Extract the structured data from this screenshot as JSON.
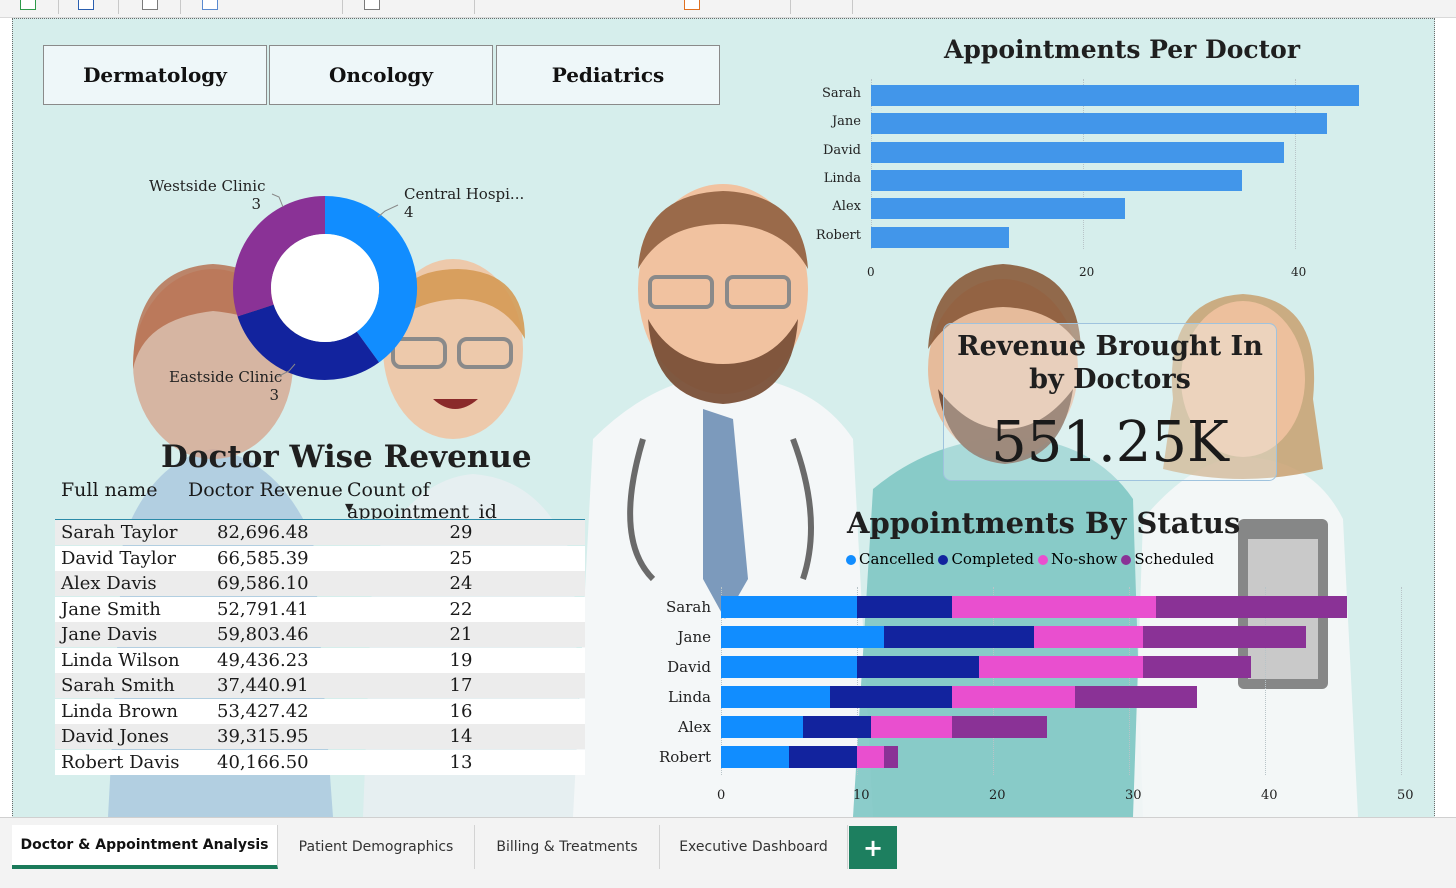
{
  "slicers": [
    "Dermatology",
    "Oncology",
    "Pediatrics"
  ],
  "donut": {
    "slices": [
      {
        "label": "Central Hospi...",
        "value": 4,
        "color": "#118dff"
      },
      {
        "label": "Eastside Clinic",
        "value": 3,
        "color": "#12239e"
      },
      {
        "label": "Westside Clinic",
        "value": 3,
        "color": "#8a3296"
      }
    ]
  },
  "appointments_per_doctor": {
    "title": "Appointments Per Doctor",
    "ticks": [
      "0",
      "20",
      "40"
    ]
  },
  "kpi": {
    "title": "Revenue Brought In by Doctors",
    "value": "551.25K"
  },
  "doctor_wise_revenue": {
    "title": "Doctor Wise Revenue",
    "columns": [
      "Full name",
      "Doctor Revenue",
      "Count of appointment_id"
    ],
    "sort_indicator": "▼",
    "rows": [
      [
        "Sarah Taylor",
        "82,696.48",
        "29"
      ],
      [
        "David Taylor",
        "66,585.39",
        "25"
      ],
      [
        "Alex Davis",
        "69,586.10",
        "24"
      ],
      [
        "Jane Smith",
        "52,791.41",
        "22"
      ],
      [
        "Jane Davis",
        "59,803.46",
        "21"
      ],
      [
        "Linda Wilson",
        "49,436.23",
        "19"
      ],
      [
        "Sarah Smith",
        "37,440.91",
        "17"
      ],
      [
        "Linda Brown",
        "53,427.42",
        "16"
      ],
      [
        "David Jones",
        "39,315.95",
        "14"
      ],
      [
        "Robert Davis",
        "40,166.50",
        "13"
      ]
    ]
  },
  "appointments_by_status": {
    "title": "Appointments By Status",
    "ticks": [
      "0",
      "10",
      "20",
      "30",
      "40",
      "50"
    ]
  },
  "chart_data": [
    {
      "type": "bar",
      "orientation": "horizontal",
      "title": "Appointments Per Doctor",
      "categories": [
        "Sarah",
        "Jane",
        "David",
        "Linda",
        "Alex",
        "Robert"
      ],
      "values": [
        46,
        43,
        39,
        35,
        24,
        13
      ],
      "xlim": [
        0,
        50
      ],
      "color": "#4296ea"
    },
    {
      "type": "bar",
      "orientation": "horizontal",
      "stacked": true,
      "title": "Appointments By Status",
      "categories": [
        "Sarah",
        "Jane",
        "David",
        "Linda",
        "Alex",
        "Robert"
      ],
      "series": [
        {
          "name": "Cancelled",
          "color": "#118dff",
          "values": [
            10,
            12,
            10,
            8,
            6,
            5
          ]
        },
        {
          "name": "Completed",
          "color": "#12239e",
          "values": [
            7,
            11,
            9,
            9,
            5,
            5
          ]
        },
        {
          "name": "No-show",
          "color": "#e94fcf",
          "values": [
            15,
            8,
            12,
            9,
            6,
            2
          ]
        },
        {
          "name": "Scheduled",
          "color": "#8a3296",
          "values": [
            14,
            12,
            8,
            9,
            7,
            1
          ]
        }
      ],
      "xlim": [
        0,
        50
      ],
      "legend": "top"
    },
    {
      "type": "pie",
      "variant": "donut",
      "categories": [
        "Central Hospi...",
        "Eastside Clinic",
        "Westside Clinic"
      ],
      "values": [
        4,
        3,
        3
      ]
    }
  ],
  "tabs": [
    "Doctor & Appointment Analysis",
    "Patient Demographics",
    "Billing & Treatments",
    "Executive Dashboard"
  ],
  "add_tab_label": "+"
}
